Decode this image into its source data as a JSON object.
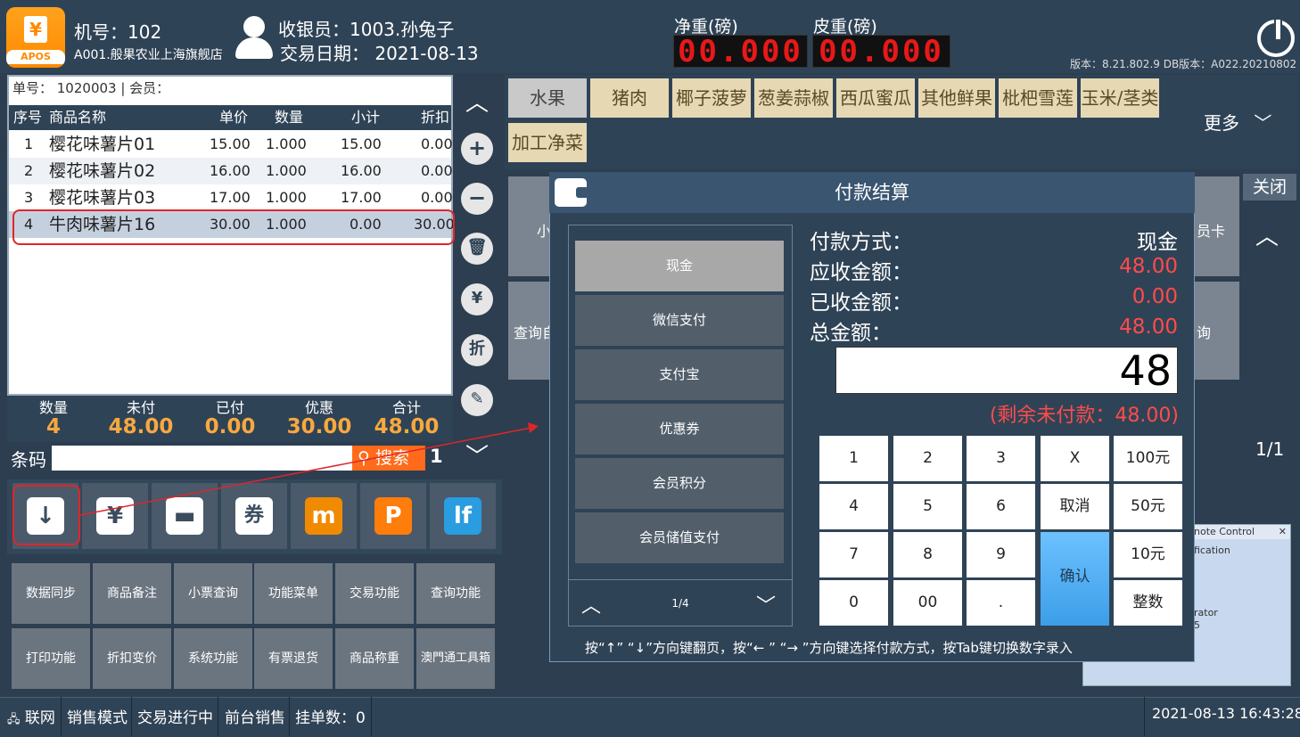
{
  "header": {
    "logo_text": "APOS",
    "machine_no": "机号：102",
    "store": "A001.般果农业上海旗舰店",
    "cashier": "收银员：1003.孙兔子",
    "trade_date": "交易日期：  2021-08-13",
    "net_weight_label": "净重(磅)",
    "net_weight_value": "00.000",
    "tare_weight_label": "皮重(磅)",
    "tare_weight_value": "00.000",
    "version": "版本：8.21.802.9 DB版本：A022.20210802"
  },
  "order": {
    "info": "单号：  1020003   | 会员：",
    "columns": [
      "序号",
      "商品名称",
      "单价",
      "数量",
      "小计",
      "折扣"
    ],
    "rows": [
      {
        "no": "1",
        "name": "樱花味薯片01",
        "price": "15.00",
        "qty": "1.000",
        "subtotal": "15.00",
        "discount": "0.00"
      },
      {
        "no": "2",
        "name": "樱花味薯片02",
        "price": "16.00",
        "qty": "1.000",
        "subtotal": "16.00",
        "discount": "0.00"
      },
      {
        "no": "3",
        "name": "樱花味薯片03",
        "price": "17.00",
        "qty": "1.000",
        "subtotal": "17.00",
        "discount": "0.00"
      },
      {
        "no": "4",
        "name": "牛肉味薯片16",
        "price": "30.00",
        "qty": "1.000",
        "subtotal": "0.00",
        "discount": "30.00"
      }
    ]
  },
  "summary": {
    "labels": [
      "数量",
      "未付",
      "已付",
      "优惠",
      "合计"
    ],
    "values": [
      "4",
      "48.00",
      "0.00",
      "30.00",
      "48.00"
    ]
  },
  "barcode": {
    "label": "条码",
    "search": "搜索",
    "count": "1"
  },
  "paymethod_icons": [
    {
      "icon": "download-icon",
      "glyph": "↓"
    },
    {
      "icon": "yen-icon",
      "glyph": "¥"
    },
    {
      "icon": "card-icon",
      "glyph": "▬"
    },
    {
      "icon": "coupon-icon",
      "glyph": "券"
    },
    {
      "icon": "macau-pass-icon",
      "glyph": "m"
    },
    {
      "icon": "p-pay-icon",
      "glyph": "P"
    },
    {
      "icon": "lf-icon",
      "glyph": "lf"
    }
  ],
  "functions": [
    "数据同步",
    "商品备注",
    "小票查询",
    "功能菜单",
    "交易功能",
    "查询功能",
    "打印功能",
    "折扣变价",
    "系统功能",
    "有票退货",
    "商品称重",
    "澳門通工具箱"
  ],
  "categories": [
    "水果",
    "猪肉",
    "椰子菠萝",
    "葱姜蒜椒",
    "西瓜蜜瓜",
    "其他鲜果",
    "枇杷雪莲",
    "玉米/茎类",
    "加工净菜"
  ],
  "more": "更多",
  "product_fragments": [
    "小",
    "查询自",
    "员卡",
    "询"
  ],
  "close": "关闭",
  "page": "1/1",
  "remote": {
    "title": "note Control",
    "line1": "fication",
    "line2": "rator",
    "line3": "5"
  },
  "dialog": {
    "title": "付款结算",
    "methods": [
      "现金",
      "微信支付",
      "支付宝",
      "优惠券",
      "会员积分",
      "会员储值支付"
    ],
    "methods_page": "1/4",
    "pay_type_label": "付款方式：",
    "pay_type_value": "现金",
    "receivable_label": "应收金额：",
    "receivable_value": "48.00",
    "received_label": "已收金额：",
    "received_value": "0.00",
    "total_label": "总金额：",
    "total_value": "48.00",
    "amount_input": "48",
    "remaining": "(剩余未付款：48.00)",
    "keys": [
      "1",
      "2",
      "3",
      "X",
      "100元",
      "4",
      "5",
      "6",
      "取消",
      "50元",
      "7",
      "8",
      "9",
      "确认",
      "10元",
      "0",
      "00",
      ".",
      "整数"
    ],
    "hint": "按“↑”  “↓”方向键翻页，按“← ” “→ ”方向键选择付款方式，按Tab键切换数字录入"
  },
  "status": {
    "net": "联网",
    "mode": "销售模式",
    "trade": "交易进行中",
    "front": "前台销售",
    "hold": "挂单数：0",
    "datetime": "2021-08-13 16:43:28"
  },
  "colors": {
    "accent": "#f7a83e",
    "red": "#ff4b4b",
    "panel": "#2f4356",
    "confirm": "#4aa8f0"
  }
}
